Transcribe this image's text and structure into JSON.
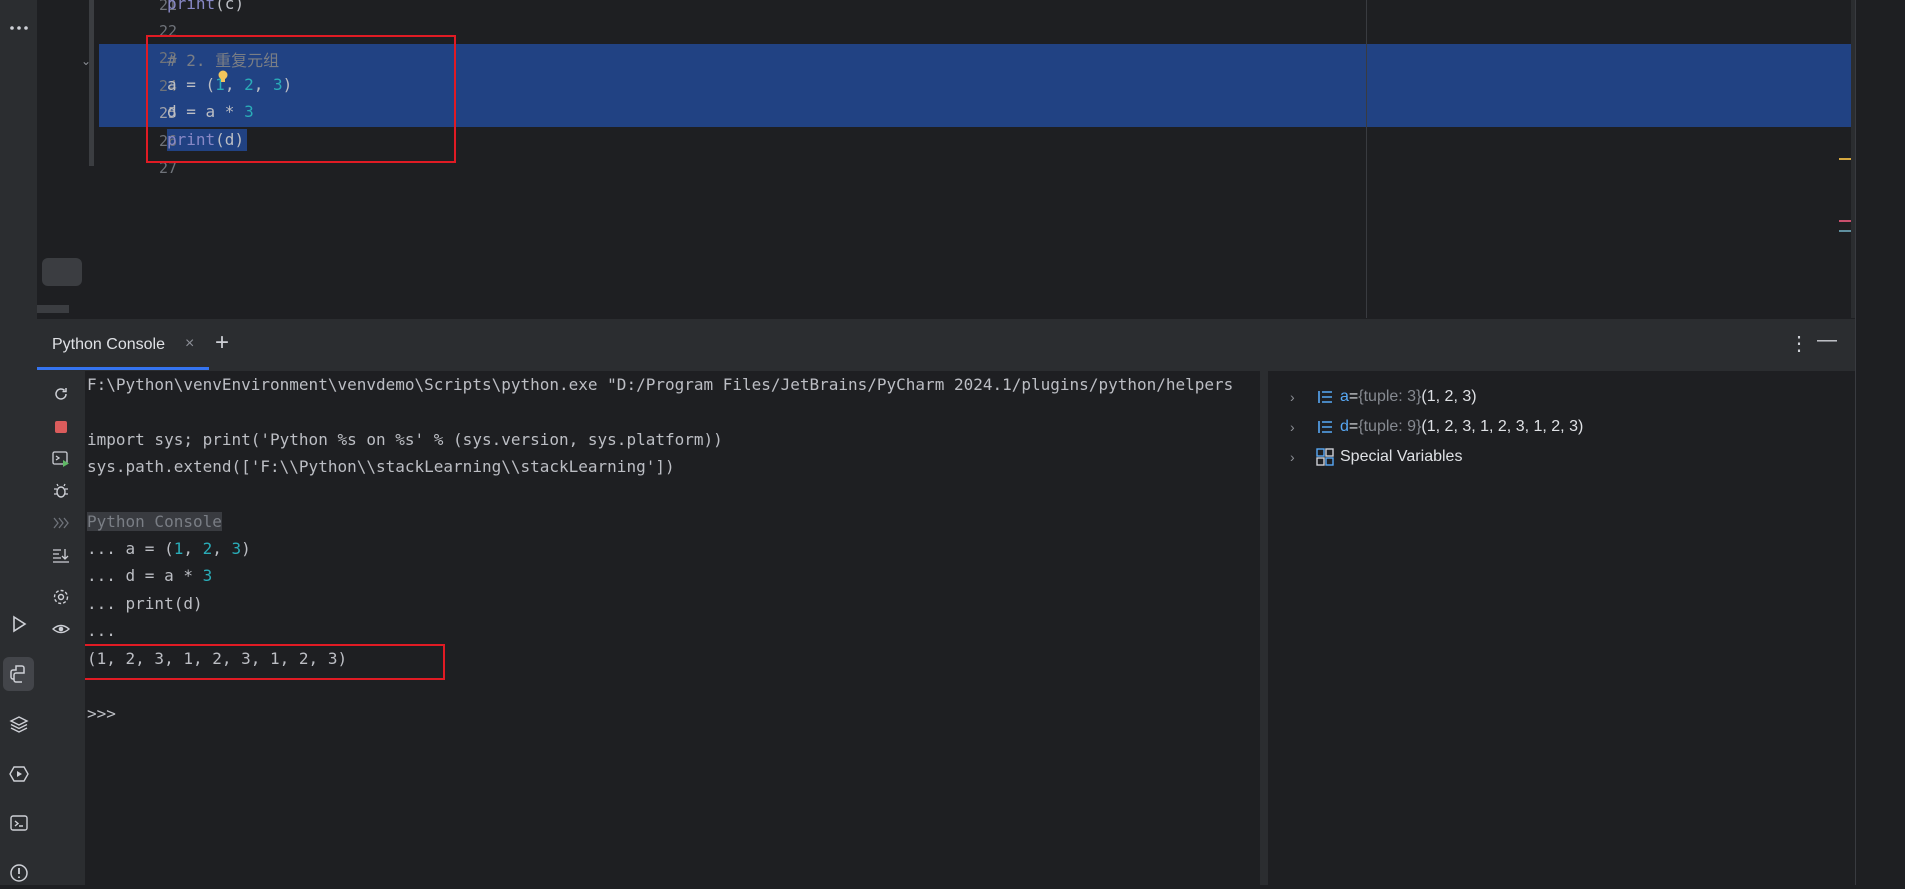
{
  "editor": {
    "lines": [
      {
        "num": "21",
        "text": "print(c)"
      },
      {
        "num": "22",
        "text": ""
      },
      {
        "num": "23",
        "text": "# 2. 重复元组"
      },
      {
        "num": "24",
        "text": "a = (1, 2, 3)"
      },
      {
        "num": "25",
        "text": "d = a * 3"
      },
      {
        "num": "26",
        "text": "print(d)"
      },
      {
        "num": "27",
        "text": ""
      }
    ],
    "tokens": {
      "l21_fn": "print",
      "l21_rest": "(c)",
      "l23_comment": "# 2. 重复元组",
      "l24_a": "a = (",
      "l24_1": "1",
      "l24_c1": ", ",
      "l24_2": "2",
      "l24_c2": ", ",
      "l24_3": "3",
      "l24_end": ")",
      "l25_a": "d = a * ",
      "l25_3": "3",
      "l26_fn": "print",
      "l26_rest": "(d)"
    }
  },
  "console": {
    "tab_label": "Python Console",
    "tab_close": "×",
    "tab_add": "+",
    "more": "⋮",
    "hide": "—",
    "lines": {
      "l1": "F:\\Python\\venvEnvironment\\venvdemo\\Scripts\\python.exe \"D:/Program Files/JetBrains/PyCharm 2024.1/plugins/python/helpers",
      "l2": "import sys; print('Python %s on %s' % (sys.version, sys.platform))",
      "l3": "sys.path.extend(['F:\\\\Python\\\\stackLearning\\\\stackLearning'])",
      "l4": "Python Console",
      "l5a": "... a = (",
      "l5_1": "1",
      "l5_c1": ", ",
      "l5_2": "2",
      "l5_c2": ", ",
      "l5_3": "3",
      "l5_end": ")",
      "l6a": "... d = a * ",
      "l6_3": "3",
      "l7": "... print(d)",
      "l8": "...",
      "l9": "(1, 2, 3, 1, 2, 3, 1, 2, 3)",
      "l10": ">>>"
    }
  },
  "variables": [
    {
      "name": "a",
      "eq": " = ",
      "type": "{tuple: 3}",
      "value": " (1, 2, 3)"
    },
    {
      "name": "d",
      "eq": " = ",
      "type": "{tuple: 9}",
      "value": " (1, 2, 3, 1, 2, 3, 1, 2, 3)"
    },
    {
      "label": "Special Variables"
    }
  ],
  "colors": {
    "selection": "#214283",
    "highlight_box": "#e01b24",
    "accent": "#3574f0"
  },
  "icons": {
    "left_strip": [
      "more-icon",
      "run-icon",
      "python-console-icon",
      "layers-icon",
      "services-icon",
      "terminal-icon",
      "problems-icon"
    ],
    "console_toolbar": [
      "rerun-icon",
      "stop-icon",
      "new-console-icon",
      "debug-icon",
      "history-icon",
      "scroll-end-icon",
      "settings-icon",
      "watch-icon"
    ]
  }
}
